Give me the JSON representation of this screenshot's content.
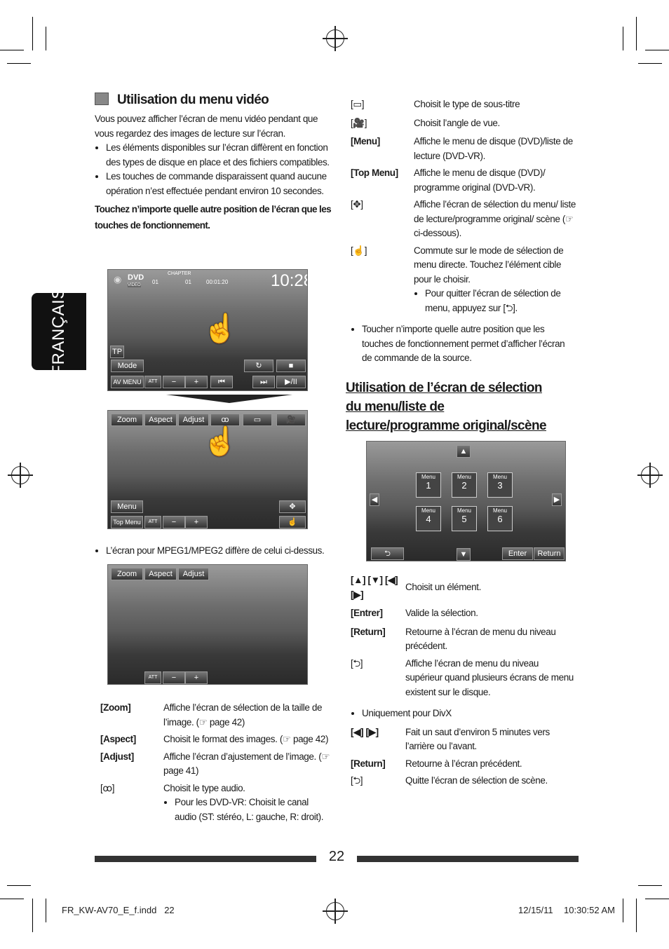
{
  "side_tab": "FRANÇAIS",
  "left": {
    "title": "Utilisation du menu vidéo",
    "intro": "Vous pouvez afficher l’écran de menu vidéo pendant que vous regardez des images de lecture sur l’écran.",
    "bullets": [
      "Les éléments disponibles sur l’écran diffèrent en fonction des types de disque en place et des fichiers compatibles.",
      "Les touches de commande disparaissent quand aucune opération n’est effectuée pendant environ 10 secondes."
    ],
    "bold_note": "Touchez n’importe quelle autre position de l’écran que les touches de fonctionnement.",
    "screen1": {
      "source": "DVD",
      "sub": "VIDEO",
      "chapter": "CHAPTER",
      "title_no": "01",
      "chapter_no": "01",
      "time": "00:01:20",
      "clock": "10:28",
      "tp": "TP",
      "mode": "Mode",
      "av_menu": "AV MENU",
      "att": "ATT"
    },
    "screen2": {
      "zoom": "Zoom",
      "aspect": "Aspect",
      "adjust": "Adjust",
      "menu": "Menu",
      "top_menu": "Top Menu",
      "att": "ATT"
    },
    "mpeg_note": "L’écran pour MPEG1/MPEG2 diffère de celui ci-dessus.",
    "screen3": {
      "zoom": "Zoom",
      "aspect": "Aspect",
      "adjust": "Adjust",
      "att": "ATT"
    },
    "defs": [
      {
        "key": "[Zoom]",
        "desc": "Affiche l’écran de sélection de la taille de l’image. (☞ page 42)"
      },
      {
        "key": "[Aspect]",
        "desc": "Choisit le format des images. (☞ page 42)"
      },
      {
        "key": "[Adjust]",
        "desc": "Affiche l’écran d’ajustement de l’image. (☞ page 41)"
      },
      {
        "key": "[ꝏ]",
        "desc": "Choisit le type audio.",
        "sub": "Pour les DVD-VR: Choisit le canal audio (ST: stéréo, L: gauche, R: droit)."
      }
    ]
  },
  "right": {
    "defs": [
      {
        "key": "[▭]",
        "desc": "Choisit le type de sous-titre"
      },
      {
        "key": "[🎥]",
        "desc": "Choisit l’angle de vue."
      },
      {
        "key": "[Menu]",
        "desc": "Affiche le menu de disque (DVD)/liste de lecture (DVD-VR)."
      },
      {
        "key": "[Top Menu]",
        "desc": "Affiche le menu de disque (DVD)/ programme original (DVD-VR)."
      },
      {
        "key": "[✥]",
        "desc": "Affiche l’écran de sélection du menu/ liste de lecture/programme original/ scène (☞ ci-dessous)."
      },
      {
        "key": "[☝]",
        "desc": "Commute sur le mode de sélection de menu directe. Touchez l’élément cible pour le choisir.",
        "sub": "Pour quitter l’écran de sélection de menu, appuyez sur [⮌]."
      }
    ],
    "bullet": "Toucher n’importe quelle autre position que les touches de fonctionnement permet d’afficher l’écran de commande de la source.",
    "heading": "Utilisation de l’écran de sélection du menu/liste de lecture/programme original/scène",
    "screen": {
      "menu_label": "Menu",
      "items": [
        "1",
        "2",
        "3",
        "4",
        "5",
        "6"
      ],
      "enter": "Enter",
      "return": "Return"
    },
    "defs2": [
      {
        "key": "[▲] [▼] [◀] [▶]",
        "desc": "Choisit un élément."
      },
      {
        "key": "[Entrer]",
        "desc": "Valide la sélection."
      },
      {
        "key": "[Return]",
        "desc": "Retourne à l’écran de menu du niveau précédent."
      },
      {
        "key": "[⮌]",
        "desc": "Affiche l’écran de menu du niveau supérieur quand plusieurs écrans de menu existent sur le disque."
      }
    ],
    "divx_bullet": "Uniquement pour DivX",
    "defs3": [
      {
        "key": "[◀] [▶]",
        "desc": "Fait un saut d’environ 5 minutes vers l’arrière ou l’avant."
      },
      {
        "key": "[Return]",
        "desc": "Retourne à l’écran précédent."
      },
      {
        "key": "[⮌]",
        "desc": "Quitte l’écran de sélection de scène."
      }
    ]
  },
  "page_number": "22",
  "footer": {
    "file": "FR_KW-AV70_E_f.indd   22",
    "date": "12/15/11",
    "time": "10:30:52 AM"
  }
}
